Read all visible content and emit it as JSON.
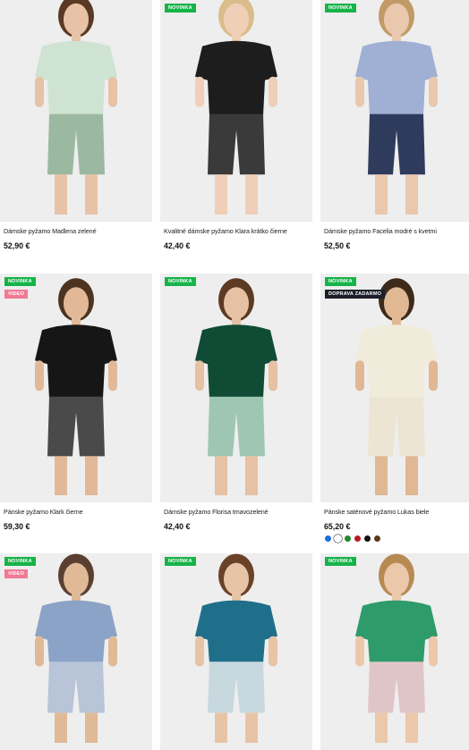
{
  "products": [
    {
      "title": "Dámske pyžamo Madlena zelené",
      "price": "52,90 €",
      "badges": [],
      "garment_colors": {
        "top": "#cfe3d3",
        "bottom": "#9bb9a1",
        "skin": "#e7c2a6",
        "hair": "#5a3a25"
      }
    },
    {
      "title": "Kvalitné dámske pyžamo Klara krátko čierne",
      "price": "42,40 €",
      "badges": [
        {
          "label": "NOVINKA",
          "type": "new"
        }
      ],
      "garment_colors": {
        "top": "#1d1d1d",
        "bottom": "#3a3a3a",
        "skin": "#efcfb7",
        "hair": "#d9bd8a"
      }
    },
    {
      "title": "Dámske pyžamo Facelia modré s kvetmi",
      "price": "52,50 €",
      "badges": [
        {
          "label": "NOVINKA",
          "type": "new"
        }
      ],
      "garment_colors": {
        "top": "#9fb0d4",
        "bottom": "#2f3b5c",
        "skin": "#e9c8ad",
        "hair": "#c19a66"
      }
    },
    {
      "title": "Pánske pyžamo Klark čierne",
      "price": "59,30 €",
      "badges": [
        {
          "label": "NOVINKA",
          "type": "new"
        },
        {
          "label": "VIDEO",
          "type": "video"
        }
      ],
      "garment_colors": {
        "top": "#161616",
        "bottom": "#4a4a4a",
        "skin": "#e2b998",
        "hair": "#4c3420"
      }
    },
    {
      "title": "Dámske pyžamo Florisa tmavozelené",
      "price": "42,40 €",
      "badges": [
        {
          "label": "NOVINKA",
          "type": "new"
        }
      ],
      "garment_colors": {
        "top": "#0f4b35",
        "bottom": "#9fc6b3",
        "skin": "#e6c1a3",
        "hair": "#5c3a24"
      }
    },
    {
      "title": "Pánske saténové pyžamo Lukas biele",
      "price": "65,20 €",
      "badges": [
        {
          "label": "NOVINKA",
          "type": "new"
        },
        {
          "label": "DOPRAVA ZADARMO",
          "type": "free"
        }
      ],
      "garment_colors": {
        "top": "#f1ebdc",
        "bottom": "#ece5d4",
        "skin": "#e0b893",
        "hair": "#3d2a1a"
      },
      "swatches": [
        {
          "color": "#1e6fe0",
          "selected": false
        },
        {
          "color": "#ffffff",
          "selected": true
        },
        {
          "color": "#1f8a2c",
          "selected": false
        },
        {
          "color": "#b81a22",
          "selected": false
        },
        {
          "color": "#111111",
          "selected": false
        },
        {
          "color": "#5a3a1a",
          "selected": false
        }
      ]
    },
    {
      "title": "",
      "price": "",
      "badges": [
        {
          "label": "NOVINKA",
          "type": "new"
        },
        {
          "label": "VIDEO",
          "type": "video"
        }
      ],
      "garment_colors": {
        "top": "#8aa3c6",
        "bottom": "#b8c4d8",
        "skin": "#e0b997",
        "hair": "#5a4030"
      }
    },
    {
      "title": "",
      "price": "",
      "badges": [
        {
          "label": "NOVINKA",
          "type": "new"
        }
      ],
      "garment_colors": {
        "top": "#1f6f8a",
        "bottom": "#c7d8de",
        "skin": "#e8c4a6",
        "hair": "#6a4129"
      }
    },
    {
      "title": "",
      "price": "",
      "badges": [
        {
          "label": "NOVINKA",
          "type": "new"
        }
      ],
      "garment_colors": {
        "top": "#2e9b6a",
        "bottom": "#e0c5c8",
        "skin": "#ecc8ab",
        "hair": "#b88a52"
      }
    }
  ]
}
